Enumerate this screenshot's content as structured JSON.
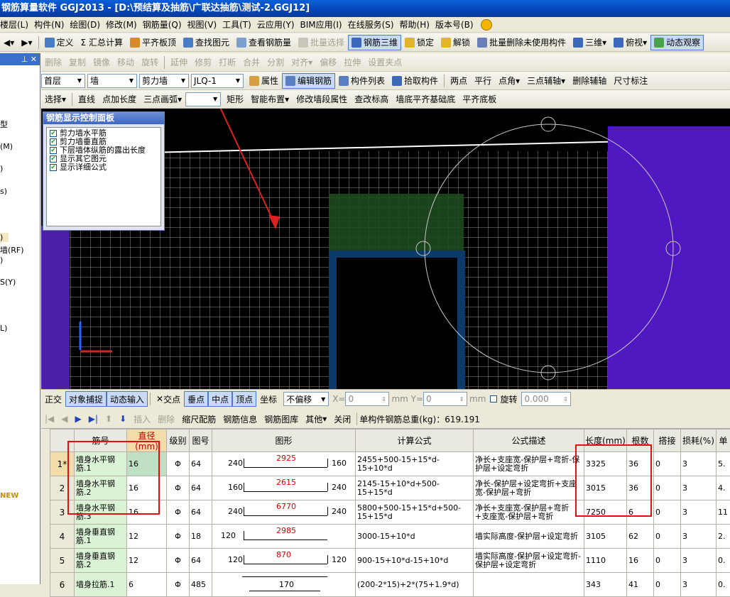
{
  "title": "钢筋算量软件 GGJ2013 - [D:\\预结算及抽筋\\广联达抽筋\\测试-2.GGJ12]",
  "menu": [
    "楼层(L)",
    "构件(N)",
    "绘图(D)",
    "修改(M)",
    "钢筋量(Q)",
    "视图(V)",
    "工具(T)",
    "云应用(Y)",
    "BIM应用(I)",
    "在线服务(S)",
    "帮助(H)",
    "版本号(B)"
  ],
  "toolbar1": [
    "定义",
    "Σ 汇总计算",
    "平齐板顶",
    "查找图元",
    "查看钢筋量",
    "批量选择",
    "钢筋三维",
    "锁定",
    "解锁",
    "批量删除未使用构件",
    "三维",
    "俯视",
    "动态观察"
  ],
  "toolbar2": [
    "删除",
    "复制",
    "镜像",
    "移动",
    "旋转",
    "延伸",
    "修剪",
    "打断",
    "合并",
    "分割",
    "对齐",
    "偏移",
    "拉伸",
    "设置夹点"
  ],
  "toolbar3": {
    "floor": "首层",
    "type": "墙",
    "subtype": "剪力墙",
    "element": "JLQ-1",
    "buttons": [
      "属性",
      "编辑钢筋",
      "构件列表",
      "拾取构件",
      "两点",
      "平行",
      "点角",
      "三点辅轴",
      "删除辅轴",
      "尺寸标注"
    ]
  },
  "toolbar4": [
    "选择",
    "直线",
    "点加长度",
    "三点画弧",
    "矩形",
    "智能布置",
    "修改墙段属性",
    "查改标高",
    "墙底平齐基础底",
    "平齐底板"
  ],
  "left_panel": {
    "labels": [
      "型",
      "(M)",
      ")",
      "s)",
      "",
      ")",
      "墙(RF)",
      ")",
      "S(Y)",
      "L)",
      "NEW"
    ]
  },
  "control_panel": {
    "title": "钢筋显示控制面板",
    "items": [
      "剪力墙水平筋",
      "剪力墙垂直筋",
      "下层墙体纵筋的露出长度",
      "显示其它图元",
      "显示详细公式"
    ]
  },
  "statusbar": {
    "items": [
      "正交",
      "对象捕捉",
      "动态输入",
      "交点",
      "垂点",
      "中点",
      "顶点",
      "坐标"
    ],
    "offset_mode": "不偏移",
    "x_label": "X=",
    "x_val": "0",
    "y_label": "mm Y=",
    "y_val": "0",
    "mm": "mm",
    "rotate": "旋转",
    "rot_val": "0.000"
  },
  "rebar_toolbar": {
    "buttons": [
      "插入",
      "删除",
      "缩尺配筋",
      "钢筋信息",
      "钢筋图库",
      "其他",
      "关闭"
    ],
    "total_label": "单构件钢筋总重(kg)：619.191"
  },
  "table": {
    "headers": [
      "",
      "筋号",
      "直径(mm)",
      "级别",
      "图号",
      "图形",
      "计算公式",
      "公式描述",
      "长度(mm)",
      "根数",
      "搭接",
      "损耗(%)",
      "单"
    ],
    "rows": [
      {
        "n": "1*",
        "name": "墙身水平钢筋.1",
        "dia": "16",
        "grade": "Φ",
        "fig": "64",
        "s_left": "240",
        "s_mid": "2925",
        "s_right": "160",
        "formula": "2455+500-15+15*d-15+10*d",
        "desc": "净长+支座宽-保护层+弯折-保护层+设定弯折",
        "len": "3325",
        "count": "36",
        "lap": "0",
        "loss": "3",
        "unit": "5."
      },
      {
        "n": "2",
        "name": "墙身水平钢筋.2",
        "dia": "16",
        "grade": "Φ",
        "fig": "64",
        "s_left": "160",
        "s_mid": "2615",
        "s_right": "240",
        "formula": "2145-15+10*d+500-15+15*d",
        "desc": "净长-保护层+设定弯折+支座宽-保护层+弯折",
        "len": "3015",
        "count": "36",
        "lap": "0",
        "loss": "3",
        "unit": "4."
      },
      {
        "n": "3",
        "name": "墙身水平钢筋.3",
        "dia": "16",
        "grade": "Φ",
        "fig": "64",
        "s_left": "240",
        "s_mid": "6770",
        "s_right": "240",
        "formula": "5800+500-15+15*d+500-15+15*d",
        "desc": "净长+支座宽-保护层+弯折+支座宽-保护层+弯折",
        "len": "7250",
        "count": "6",
        "lap": "0",
        "loss": "3",
        "unit": "11"
      },
      {
        "n": "4",
        "name": "墙身垂直钢筋.1",
        "dia": "12",
        "grade": "Φ",
        "fig": "18",
        "s_left": "120",
        "s_mid": "2985",
        "s_right": "",
        "formula": "3000-15+10*d",
        "desc": "墙实际高度-保护层+设定弯折",
        "len": "3105",
        "count": "62",
        "lap": "0",
        "loss": "3",
        "unit": "2."
      },
      {
        "n": "5",
        "name": "墙身垂直钢筋.2",
        "dia": "12",
        "grade": "Φ",
        "fig": "64",
        "s_left": "120",
        "s_mid": "870",
        "s_right": "120",
        "formula": "900-15+10*d-15+10*d",
        "desc": "墙实际高度-保护层+设定弯折-保护层+设定弯折",
        "len": "1110",
        "count": "16",
        "lap": "0",
        "loss": "3",
        "unit": "0."
      },
      {
        "n": "6",
        "name": "墙身拉筋.1",
        "dia": "6",
        "grade": "Φ",
        "fig": "485",
        "s_left": "",
        "s_mid": "170",
        "s_right": "",
        "formula": "(200-2*15)+2*(75+1.9*d)",
        "desc": "",
        "len": "343",
        "count": "41",
        "lap": "0",
        "loss": "3",
        "unit": "0."
      }
    ]
  }
}
